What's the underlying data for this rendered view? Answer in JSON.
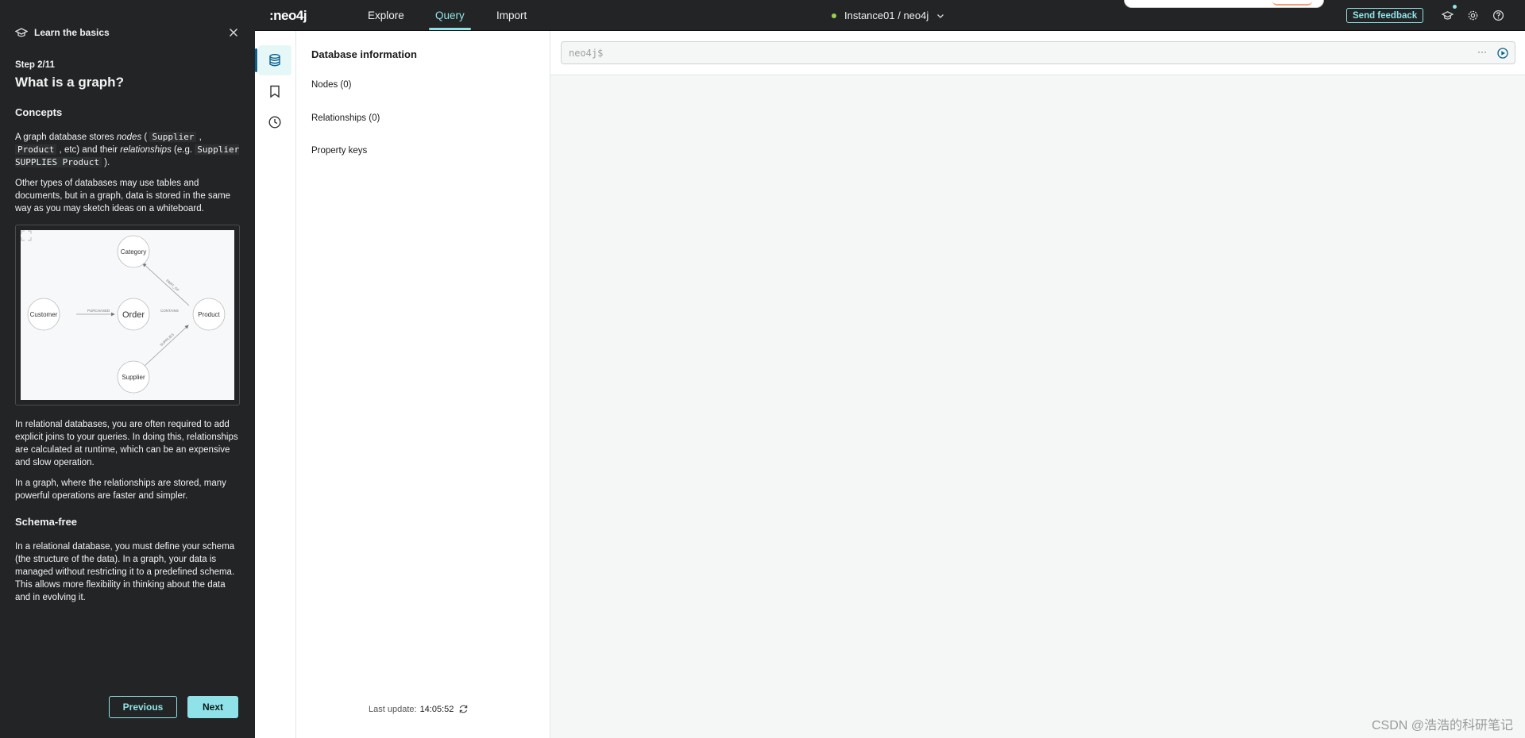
{
  "guide": {
    "title": "Learn the basics",
    "step": "Step 2/11",
    "heading": "What is a graph?",
    "concepts_heading": "Concepts",
    "p1": {
      "t1": "A graph database stores ",
      "em1": "nodes",
      "t2": " ( ",
      "c1": "Supplier",
      "t3": " , ",
      "c2": "Product",
      "t4": " , etc) and their ",
      "em2": "relationships",
      "t5": " (e.g. ",
      "c3": "Supplier SUPPLIES Product",
      "t6": " )."
    },
    "p2": "Other types of databases may use tables and documents, but in a graph, data is stored in the same way as you may sketch ideas on a whiteboard.",
    "diagram": {
      "nodes": {
        "category": "Category",
        "customer": "Customer",
        "order": "Order",
        "product": "Product",
        "supplier": "Supplier"
      },
      "rels": {
        "purchased": "PURCHASED",
        "contains": "CONTAINS",
        "part_of": "PART_OF",
        "supplies": "SUPPLIES"
      }
    },
    "p3": "In relational databases, you are often required to add explicit joins to your queries. In doing this, relationships are calculated at runtime, which can be an expensive and slow operation.",
    "p4": "In a graph, where the relationships are stored, many powerful operations are faster and simpler.",
    "schema_heading": "Schema-free",
    "p5": "In a relational database, you must define your schema (the structure of the data). In a graph, your data is managed without restricting it to a predefined schema. This allows more flexibility in thinking about the data and in evolving it.",
    "prev_label": "Previous",
    "next_label": "Next"
  },
  "topbar": {
    "logo": ":neo4j",
    "nav": [
      "Explore",
      "Query",
      "Import"
    ],
    "active_nav": "Query",
    "instance": "Instance01 / neo4j",
    "feedback": "Send feedback"
  },
  "dbinfo": {
    "title": "Database information",
    "nodes": "Nodes (0)",
    "relationships": "Relationships (0)",
    "property_keys": "Property keys",
    "last_update_label": "Last update:",
    "last_update_time": "14:05:52"
  },
  "editor": {
    "prompt": "neo4j$",
    "more": "···"
  },
  "watermark": "CSDN @浩浩的科研笔记",
  "colors": {
    "accent": "#8fe3e8",
    "dark_bg": "#222425",
    "online": "#9ad24c"
  }
}
